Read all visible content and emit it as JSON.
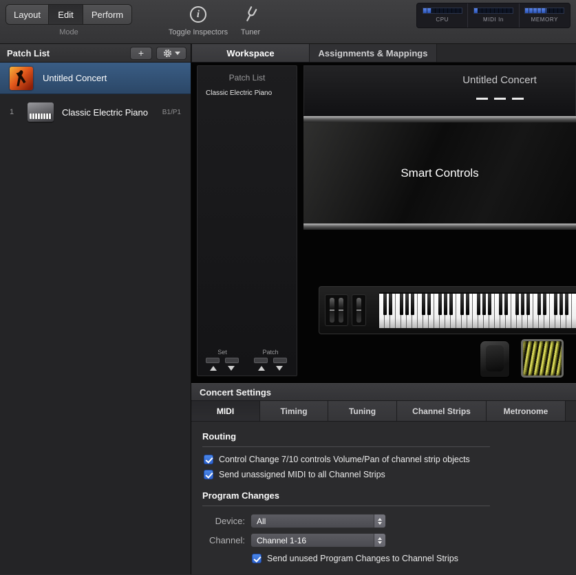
{
  "toolbar": {
    "modes": [
      {
        "label": "Layout",
        "active": false
      },
      {
        "label": "Edit",
        "active": true
      },
      {
        "label": "Perform",
        "active": false
      }
    ],
    "mode_caption": "Mode",
    "toggle_inspectors_label": "Toggle Inspectors",
    "tuner_label": "Tuner",
    "meters": [
      {
        "label": "CPU"
      },
      {
        "label": "MIDI In"
      },
      {
        "label": "MEMORY"
      }
    ]
  },
  "icons": {
    "plus": "+",
    "info": "i"
  },
  "sidebar": {
    "title": "Patch List",
    "rows": [
      {
        "label": "Untitled Concert",
        "selected": true
      },
      {
        "index": "1",
        "label": "Classic Electric Piano",
        "badge": "B1/P1",
        "selected": false
      }
    ]
  },
  "main_tabs": [
    {
      "label": "Workspace",
      "active": true
    },
    {
      "label": "Assignments & Mappings",
      "active": false
    }
  ],
  "workspace": {
    "patch_list": {
      "title": "Patch List",
      "patch_name": "Classic Electric Piano",
      "set_label": "Set",
      "patch_label": "Patch"
    },
    "concert_title": "Untitled Concert",
    "smart_controls_label": "Smart Controls"
  },
  "settings": {
    "title": "Concert Settings",
    "tabs": [
      {
        "label": "MIDI",
        "active": true
      },
      {
        "label": "Timing",
        "active": false
      },
      {
        "label": "Tuning",
        "active": false
      },
      {
        "label": "Channel Strips",
        "active": false
      },
      {
        "label": "Metronome",
        "active": false
      }
    ],
    "routing": {
      "heading": "Routing",
      "options": [
        {
          "label": "Control Change 7/10 controls Volume/Pan of channel strip objects",
          "checked": true
        },
        {
          "label": "Send unassigned MIDI to all Channel Strips",
          "checked": true
        }
      ]
    },
    "program_changes": {
      "heading": "Program Changes",
      "device_label": "Device:",
      "device_value": "All",
      "channel_label": "Channel:",
      "channel_value": "Channel 1-16",
      "option": {
        "label": "Send unused Program Changes to Channel Strips",
        "checked": true
      }
    }
  },
  "colors": {
    "accent_blue": "#3b78dd",
    "selection_blue": "#33557f",
    "meter_blue": "#3f6fd8",
    "artwork_orange": "#e2581c"
  }
}
